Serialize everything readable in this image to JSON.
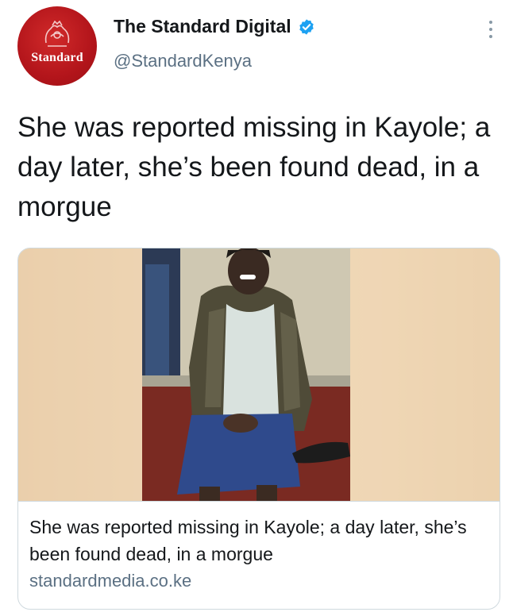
{
  "account": {
    "display_name": "The Standard Digital",
    "handle": "@StandardKenya",
    "avatar_logo_text": "Standard",
    "verified": true,
    "brand_color": "#b3151b",
    "verified_color": "#1da1f2"
  },
  "tweet": {
    "text": "She was reported missing in Kayole; a day later, she’s been found dead, in a morgue"
  },
  "link_card": {
    "title": "She was reported missing in Kayole; a day later, she’s been found dead, in a morgue",
    "domain": "standardmedia.co.ke"
  },
  "icons": [
    "verified-badge-icon",
    "more-options-icon"
  ]
}
